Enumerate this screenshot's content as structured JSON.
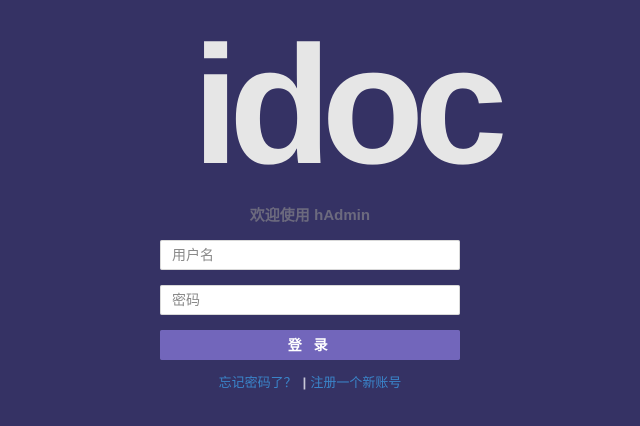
{
  "logo": {
    "text": "idoc"
  },
  "welcome": {
    "text": "欢迎使用 hAdmin"
  },
  "form": {
    "username_placeholder": "用户名",
    "password_placeholder": "密码",
    "login_label": "登 录"
  },
  "links": {
    "forgot_password": "忘记密码了？",
    "separator": "|",
    "register": "注册一个新账号"
  },
  "colors": {
    "background": "#353264",
    "logo": "#e6e6e6",
    "button": "#7266bb",
    "link": "#3a84c9"
  }
}
